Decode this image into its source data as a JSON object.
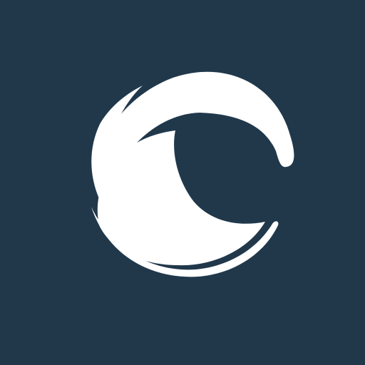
{
  "app_icon": {
    "icon": "wave-eye-logo-icon",
    "colors": {
      "background": "#21384b",
      "foreground": "#ffffff"
    }
  }
}
